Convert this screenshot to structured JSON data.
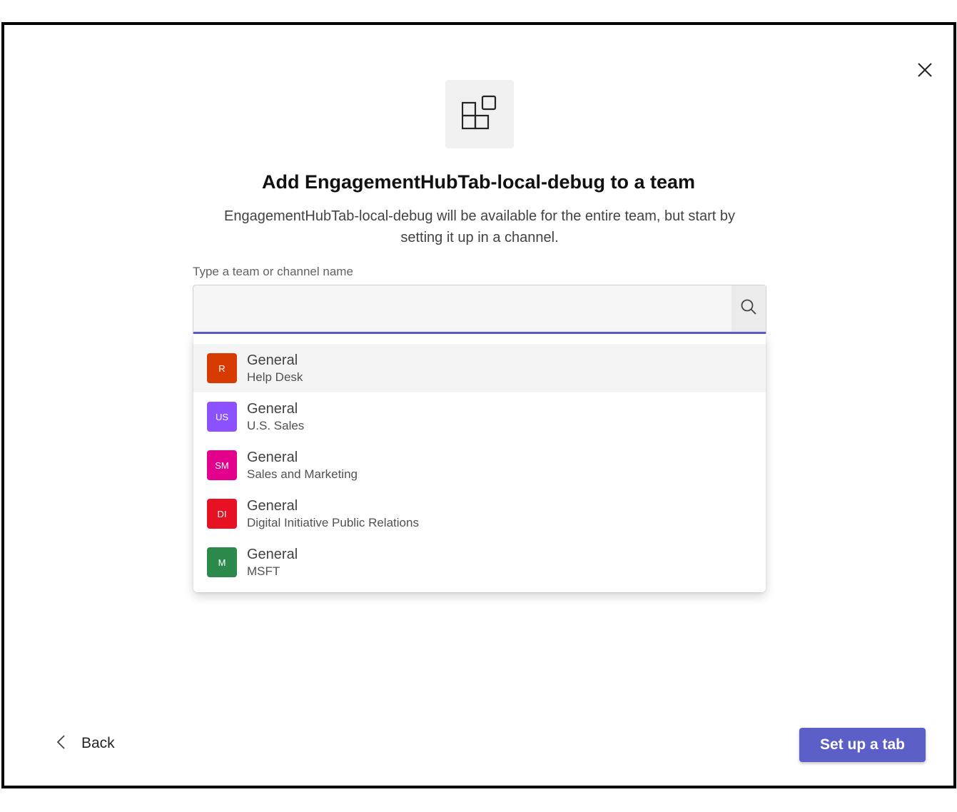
{
  "dialog": {
    "title": "Add EngagementHubTab-local-debug to a team",
    "subtitle": "EngagementHubTab-local-debug will be available for the entire team, but start by setting it up in a channel."
  },
  "icons": {
    "close": "close-icon",
    "app": "app-grid-icon",
    "search": "search-icon",
    "back": "chevron-left-icon"
  },
  "search": {
    "label": "Type a team or channel name",
    "value": "",
    "placeholder": ""
  },
  "results": [
    {
      "initials": "R",
      "channel": "General",
      "team": "Help Desk",
      "color": "#d83b01",
      "highlighted": true
    },
    {
      "initials": "US",
      "channel": "General",
      "team": "U.S. Sales",
      "color": "#8c52ff",
      "highlighted": false
    },
    {
      "initials": "SM",
      "channel": "General",
      "team": "Sales and Marketing",
      "color": "#e3008c",
      "highlighted": false
    },
    {
      "initials": "DI",
      "channel": "General",
      "team": "Digital Initiative Public Relations",
      "color": "#e81123",
      "highlighted": false
    },
    {
      "initials": "M",
      "channel": "General",
      "team": "MSFT",
      "color": "#2b8a4b",
      "highlighted": false
    }
  ],
  "footer": {
    "back_label": "Back",
    "primary_label": "Set up a tab"
  },
  "colors": {
    "accent": "#5b5fc7"
  }
}
